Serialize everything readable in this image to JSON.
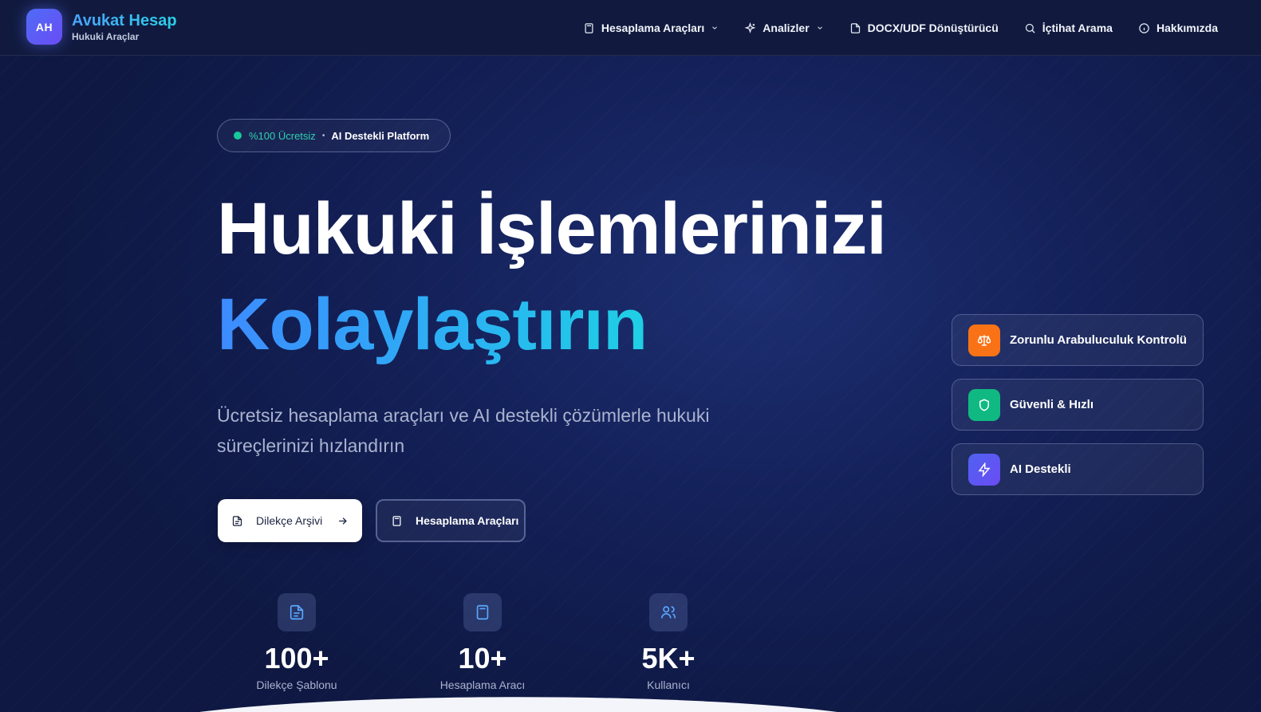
{
  "brand": {
    "logo_initials": "AH",
    "title": "Avukat Hesap",
    "subtitle": "Hukuki Araçlar"
  },
  "nav": [
    {
      "label": "Hesaplama Araçları",
      "icon": "calculator-icon",
      "dropdown": true
    },
    {
      "label": "Analizler",
      "icon": "sparkles-icon",
      "dropdown": true
    },
    {
      "label": "DOCX/UDF Dönüştürücü",
      "icon": "file-icon",
      "dropdown": false
    },
    {
      "label": "İçtihat Arama",
      "icon": "search-icon",
      "dropdown": false
    },
    {
      "label": "Hakkımızda",
      "icon": "info-icon",
      "dropdown": false
    }
  ],
  "hero": {
    "pill": {
      "free": "%100 Ücretsiz",
      "separator": "•",
      "ai": "AI Destekli Platform"
    },
    "headline_line1": "Hukuki İşlemlerinizi",
    "headline_line2": "Kolaylaştırın",
    "lead": "Ücretsiz hesaplama araçları ve AI destekli çözümlerle hukuki süreçlerinizi hızlandırın",
    "primary_button": "Dilekçe Arşivi",
    "secondary_button": "Hesaplama Araçları"
  },
  "stats": [
    {
      "value": "100+",
      "label": "Dilekçe Şablonu",
      "icon": "document-icon"
    },
    {
      "value": "10+",
      "label": "Hesaplama Aracı",
      "icon": "calculator-icon"
    },
    {
      "value": "5K+",
      "label": "Kullanıcı",
      "icon": "users-icon"
    }
  ],
  "features": [
    {
      "label": "Zorunlu Arabuluculuk Kontrolü",
      "icon": "scale-icon",
      "color": "#f97316"
    },
    {
      "label": "Güvenli & Hızlı",
      "icon": "shield-icon",
      "color": "#10b981"
    },
    {
      "label": "AI Destekli",
      "icon": "lightning-icon",
      "color": "#4f62f0"
    }
  ],
  "colors": {
    "accent_blue": "#3d8bff",
    "accent_cyan": "#1fd0e4",
    "background": "#14215a"
  }
}
